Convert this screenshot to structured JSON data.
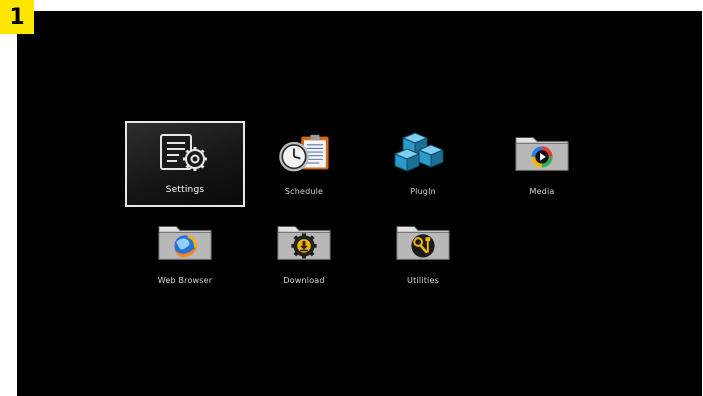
{
  "badge": {
    "text": "1",
    "color": "#ffe600"
  },
  "menu": {
    "items": [
      {
        "label": "Settings",
        "icon": "settings-icon",
        "selected": true
      },
      {
        "label": "Schedule",
        "icon": "schedule-icon",
        "selected": false
      },
      {
        "label": "PlugIn",
        "icon": "plugin-icon",
        "selected": false
      },
      {
        "label": "Media",
        "icon": "media-folder-icon",
        "selected": false
      },
      {
        "label": "Web Browser",
        "icon": "web-browser-folder-icon",
        "selected": false
      },
      {
        "label": "Download",
        "icon": "download-folder-icon",
        "selected": false
      },
      {
        "label": "Utilities",
        "icon": "utilities-folder-icon",
        "selected": false
      }
    ]
  },
  "colors": {
    "background": "#000000",
    "selection_border": "#e8e8e8",
    "label": "#d8d8d8",
    "plugin_blue": "#2a9ac8",
    "schedule_orange": "#e07820"
  }
}
